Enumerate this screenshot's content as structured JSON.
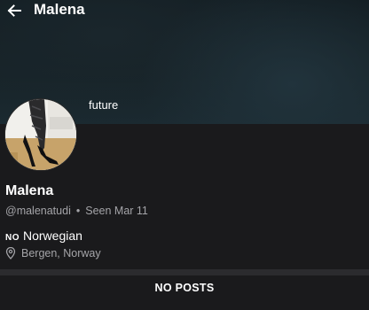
{
  "header": {
    "title": "Malena",
    "back_icon": "arrow-left-icon"
  },
  "profile": {
    "bio_snippet": "future",
    "display_name": "Malena",
    "username": "@malenatudi",
    "separator": "•",
    "last_seen": "Seen  Mar 11",
    "language_code": "NO",
    "language": "Norwegian",
    "location": "Bergen, Norway",
    "location_icon": "map-pin-icon",
    "avatar": "profile-photo"
  },
  "posts": {
    "empty_label": "NO POSTS"
  },
  "colors": {
    "background": "#1a1a1c",
    "secondary_text": "#a4a4a8",
    "divider": "#2b2b2e"
  }
}
